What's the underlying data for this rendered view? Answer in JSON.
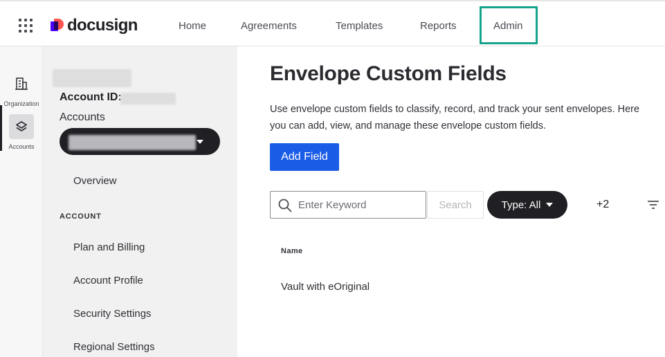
{
  "brand": {
    "name": "docusign"
  },
  "nav": {
    "items": [
      {
        "label": "Home"
      },
      {
        "label": "Agreements"
      },
      {
        "label": "Templates"
      },
      {
        "label": "Reports"
      },
      {
        "label": "Admin",
        "active": true
      }
    ],
    "highlight_color": "#14a38b"
  },
  "rail": {
    "items": [
      {
        "label": "Organization",
        "icon": "building-icon"
      },
      {
        "label": "Accounts",
        "icon": "layers-icon",
        "active": true
      }
    ]
  },
  "sidebar": {
    "account_id_label": "Account ID:",
    "accounts_label": "Accounts",
    "overview": "Overview",
    "section_heading": "ACCOUNT",
    "links": [
      "Plan and Billing",
      "Account Profile",
      "Security Settings",
      "Regional Settings"
    ]
  },
  "main": {
    "title": "Envelope Custom Fields",
    "description": "Use envelope custom fields to classify, record, and track your sent envelopes. Here you can add, view, and manage these envelope custom fields.",
    "add_button": "Add Field",
    "search": {
      "placeholder": "Enter Keyword",
      "button": "Search"
    },
    "type_filter": "Type: All",
    "more_filters": "+2",
    "table": {
      "columns": [
        "Name"
      ],
      "rows": [
        [
          "Vault with eOriginal"
        ]
      ]
    }
  },
  "colors": {
    "primary_button": "#1b5ce6",
    "dark_pill": "#1f1f24"
  }
}
